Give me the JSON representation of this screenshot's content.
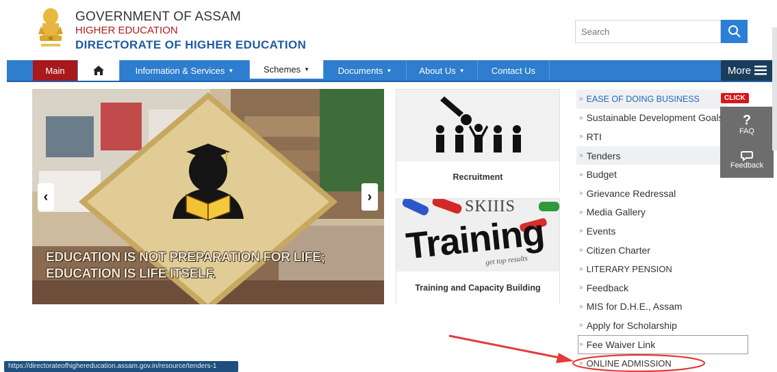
{
  "header": {
    "line1": "GOVERNMENT OF ASSAM",
    "line2": "HIGHER EDUCATION",
    "line3": "DIRECTORATE OF HIGHER EDUCATION"
  },
  "search": {
    "placeholder": "Search"
  },
  "nav": {
    "main": "Main",
    "info": "Information & Services",
    "schemes": "Schemes",
    "documents": "Documents",
    "about": "About Us",
    "contact": "Contact Us",
    "more": "More"
  },
  "slider": {
    "line1": "EDUCATION IS NOT PREPARATION FOR LIFE;",
    "line2": "EDUCATION IS LIFE ITSELF."
  },
  "cards": {
    "recruitment": "Recruitment",
    "training_img_text": "Training",
    "training_top": "SKIIIS",
    "training_small": "get top results",
    "training": "Training and Capacity Building"
  },
  "links": [
    "EASE OF DOING BUSINESS",
    "Sustainable Development Goals",
    "RTI",
    "Tenders",
    "Budget",
    "Grievance Redressal",
    "Media Gallery",
    "Events",
    "Citizen Charter",
    "LITERARY PENSION",
    "Feedback",
    "MIS for D.H.E., Assam",
    "Apply for Scholarship",
    "Fee Waiver Link",
    "ONLINE ADMISSION"
  ],
  "badge": "CLICK",
  "side_panel": {
    "faq": "FAQ",
    "feedback": "Feedback"
  },
  "status_url": "https://directorateofhighereducation.assam.gov.in/resource/tenders-1",
  "colors": {
    "nav_blue": "#2e7dce",
    "main_red": "#a7191c",
    "annotation_red": "#e53a3a"
  }
}
